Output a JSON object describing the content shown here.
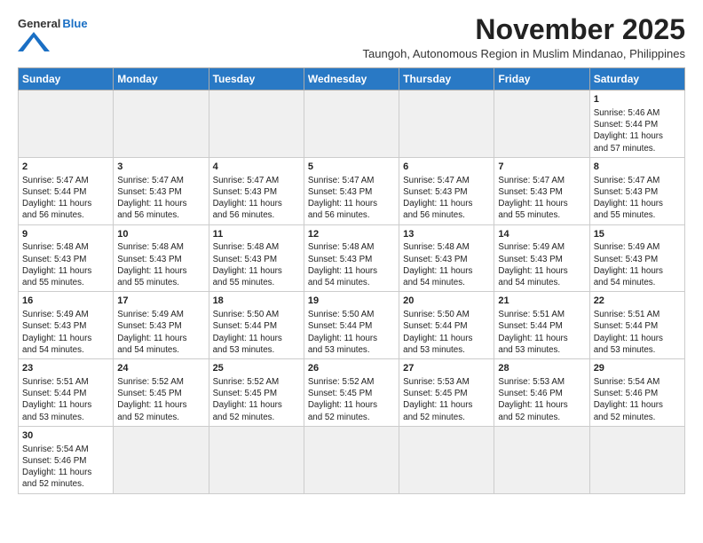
{
  "header": {
    "logo_line1": "General",
    "logo_line2": "Blue",
    "month_title": "November 2025",
    "subtitle": "Taungoh, Autonomous Region in Muslim Mindanao, Philippines"
  },
  "days_of_week": [
    "Sunday",
    "Monday",
    "Tuesday",
    "Wednesday",
    "Thursday",
    "Friday",
    "Saturday"
  ],
  "weeks": [
    [
      {
        "num": "",
        "info": ""
      },
      {
        "num": "",
        "info": ""
      },
      {
        "num": "",
        "info": ""
      },
      {
        "num": "",
        "info": ""
      },
      {
        "num": "",
        "info": ""
      },
      {
        "num": "",
        "info": ""
      },
      {
        "num": "1",
        "info": "Sunrise: 5:46 AM\nSunset: 5:44 PM\nDaylight: 11 hours\nand 57 minutes."
      }
    ],
    [
      {
        "num": "2",
        "info": "Sunrise: 5:47 AM\nSunset: 5:44 PM\nDaylight: 11 hours\nand 56 minutes."
      },
      {
        "num": "3",
        "info": "Sunrise: 5:47 AM\nSunset: 5:43 PM\nDaylight: 11 hours\nand 56 minutes."
      },
      {
        "num": "4",
        "info": "Sunrise: 5:47 AM\nSunset: 5:43 PM\nDaylight: 11 hours\nand 56 minutes."
      },
      {
        "num": "5",
        "info": "Sunrise: 5:47 AM\nSunset: 5:43 PM\nDaylight: 11 hours\nand 56 minutes."
      },
      {
        "num": "6",
        "info": "Sunrise: 5:47 AM\nSunset: 5:43 PM\nDaylight: 11 hours\nand 56 minutes."
      },
      {
        "num": "7",
        "info": "Sunrise: 5:47 AM\nSunset: 5:43 PM\nDaylight: 11 hours\nand 55 minutes."
      },
      {
        "num": "8",
        "info": "Sunrise: 5:47 AM\nSunset: 5:43 PM\nDaylight: 11 hours\nand 55 minutes."
      }
    ],
    [
      {
        "num": "9",
        "info": "Sunrise: 5:48 AM\nSunset: 5:43 PM\nDaylight: 11 hours\nand 55 minutes."
      },
      {
        "num": "10",
        "info": "Sunrise: 5:48 AM\nSunset: 5:43 PM\nDaylight: 11 hours\nand 55 minutes."
      },
      {
        "num": "11",
        "info": "Sunrise: 5:48 AM\nSunset: 5:43 PM\nDaylight: 11 hours\nand 55 minutes."
      },
      {
        "num": "12",
        "info": "Sunrise: 5:48 AM\nSunset: 5:43 PM\nDaylight: 11 hours\nand 54 minutes."
      },
      {
        "num": "13",
        "info": "Sunrise: 5:48 AM\nSunset: 5:43 PM\nDaylight: 11 hours\nand 54 minutes."
      },
      {
        "num": "14",
        "info": "Sunrise: 5:49 AM\nSunset: 5:43 PM\nDaylight: 11 hours\nand 54 minutes."
      },
      {
        "num": "15",
        "info": "Sunrise: 5:49 AM\nSunset: 5:43 PM\nDaylight: 11 hours\nand 54 minutes."
      }
    ],
    [
      {
        "num": "16",
        "info": "Sunrise: 5:49 AM\nSunset: 5:43 PM\nDaylight: 11 hours\nand 54 minutes."
      },
      {
        "num": "17",
        "info": "Sunrise: 5:49 AM\nSunset: 5:43 PM\nDaylight: 11 hours\nand 54 minutes."
      },
      {
        "num": "18",
        "info": "Sunrise: 5:50 AM\nSunset: 5:44 PM\nDaylight: 11 hours\nand 53 minutes."
      },
      {
        "num": "19",
        "info": "Sunrise: 5:50 AM\nSunset: 5:44 PM\nDaylight: 11 hours\nand 53 minutes."
      },
      {
        "num": "20",
        "info": "Sunrise: 5:50 AM\nSunset: 5:44 PM\nDaylight: 11 hours\nand 53 minutes."
      },
      {
        "num": "21",
        "info": "Sunrise: 5:51 AM\nSunset: 5:44 PM\nDaylight: 11 hours\nand 53 minutes."
      },
      {
        "num": "22",
        "info": "Sunrise: 5:51 AM\nSunset: 5:44 PM\nDaylight: 11 hours\nand 53 minutes."
      }
    ],
    [
      {
        "num": "23",
        "info": "Sunrise: 5:51 AM\nSunset: 5:44 PM\nDaylight: 11 hours\nand 53 minutes."
      },
      {
        "num": "24",
        "info": "Sunrise: 5:52 AM\nSunset: 5:45 PM\nDaylight: 11 hours\nand 52 minutes."
      },
      {
        "num": "25",
        "info": "Sunrise: 5:52 AM\nSunset: 5:45 PM\nDaylight: 11 hours\nand 52 minutes."
      },
      {
        "num": "26",
        "info": "Sunrise: 5:52 AM\nSunset: 5:45 PM\nDaylight: 11 hours\nand 52 minutes."
      },
      {
        "num": "27",
        "info": "Sunrise: 5:53 AM\nSunset: 5:45 PM\nDaylight: 11 hours\nand 52 minutes."
      },
      {
        "num": "28",
        "info": "Sunrise: 5:53 AM\nSunset: 5:46 PM\nDaylight: 11 hours\nand 52 minutes."
      },
      {
        "num": "29",
        "info": "Sunrise: 5:54 AM\nSunset: 5:46 PM\nDaylight: 11 hours\nand 52 minutes."
      }
    ],
    [
      {
        "num": "30",
        "info": "Sunrise: 5:54 AM\nSunset: 5:46 PM\nDaylight: 11 hours\nand 52 minutes."
      },
      {
        "num": "",
        "info": ""
      },
      {
        "num": "",
        "info": ""
      },
      {
        "num": "",
        "info": ""
      },
      {
        "num": "",
        "info": ""
      },
      {
        "num": "",
        "info": ""
      },
      {
        "num": "",
        "info": ""
      }
    ]
  ]
}
